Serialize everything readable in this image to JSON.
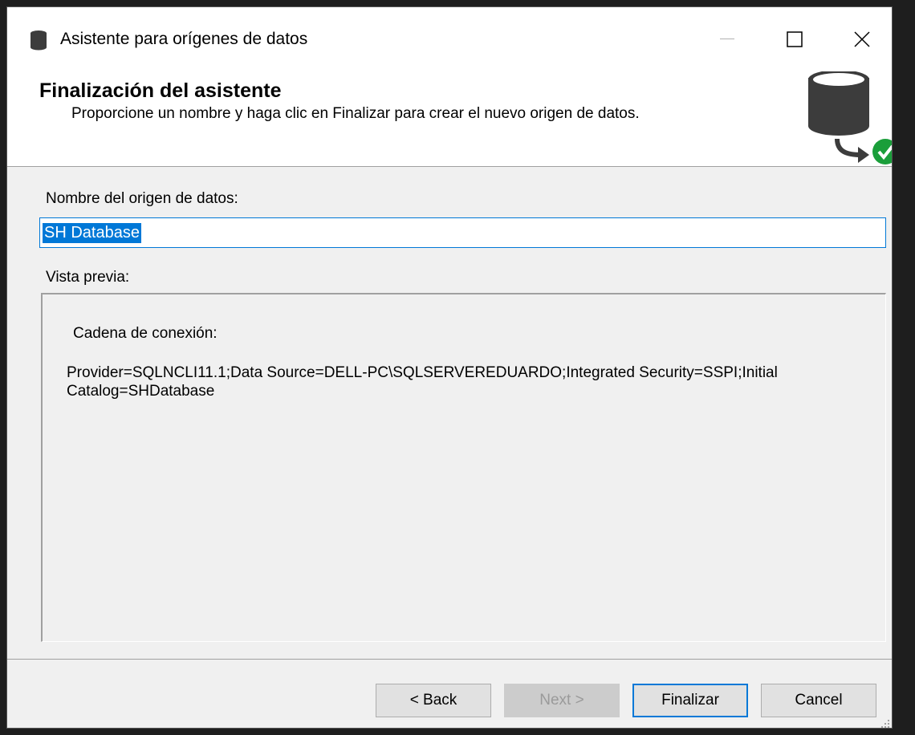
{
  "window": {
    "title": "Asistente para orígenes de datos"
  },
  "header": {
    "title": "Finalización del asistente",
    "subtitle": "Proporcione un nombre y haga clic en Finalizar para crear el nuevo origen de datos.",
    "icon": "database-check-icon"
  },
  "form": {
    "name_label": "Nombre del origen de datos:",
    "name_value": "SH Database",
    "preview_label": "Vista previa:"
  },
  "preview": {
    "connection_label": "Cadena de conexión:",
    "connection_string": "Provider=SQLNCLI11.1;Data Source=DELL-PC\\SQLSERVEREDUARDO;Integrated Security=SSPI;Initial Catalog=SHDatabase"
  },
  "buttons": {
    "back": "< Back",
    "next": "Next >",
    "finish": "Finalizar",
    "cancel": "Cancel"
  },
  "colors": {
    "accent": "#0078d7",
    "check_green": "#1a9e3a"
  }
}
